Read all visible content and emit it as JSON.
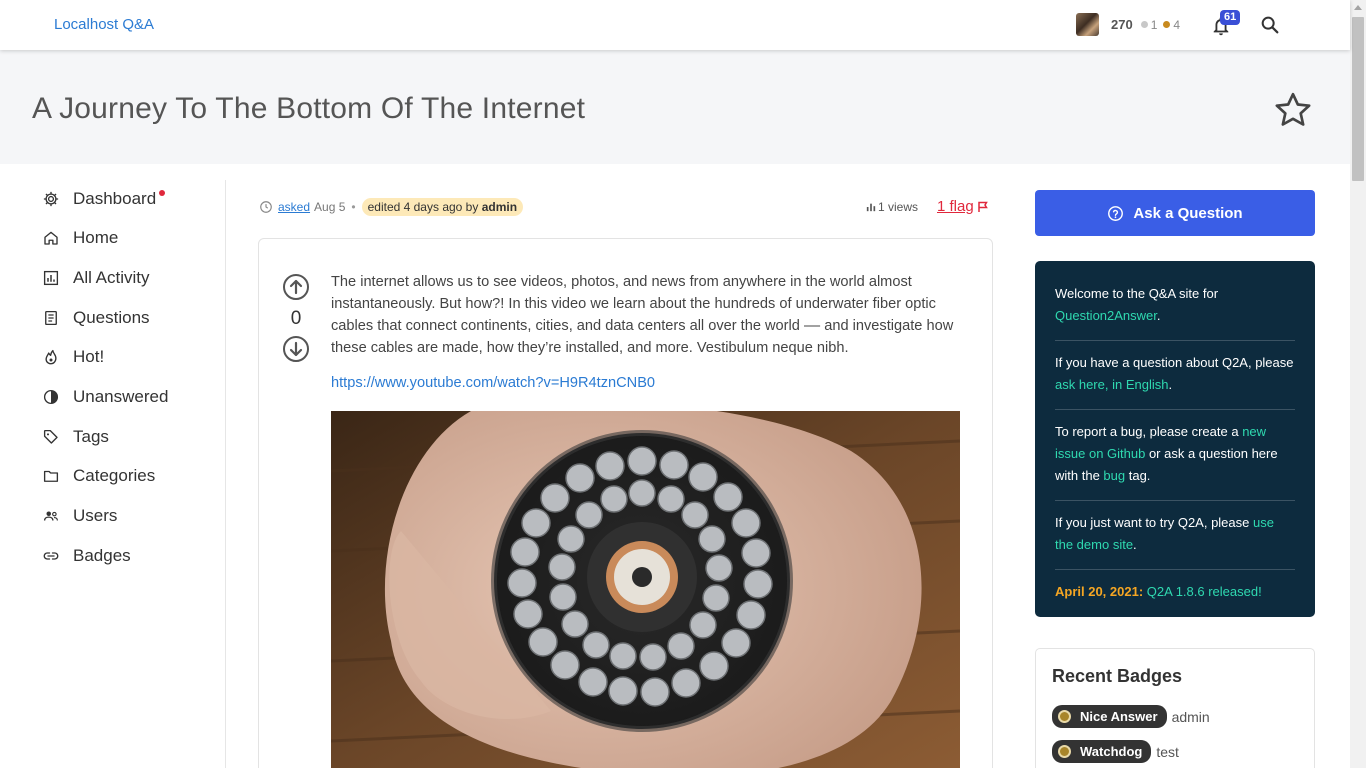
{
  "site": {
    "name": "Localhost Q&A"
  },
  "user": {
    "points": "270",
    "silver": "1",
    "bronze": "4",
    "notifications": "61"
  },
  "title": "A Journey To The Bottom Of The Internet",
  "nav": [
    {
      "label": "Dashboard"
    },
    {
      "label": "Home"
    },
    {
      "label": "All Activity"
    },
    {
      "label": "Questions"
    },
    {
      "label": "Hot!"
    },
    {
      "label": "Unanswered"
    },
    {
      "label": "Tags"
    },
    {
      "label": "Categories"
    },
    {
      "label": "Users"
    },
    {
      "label": "Badges"
    }
  ],
  "question": {
    "asked_label": "asked",
    "asked_date": "Aug 5",
    "edited_prefix": "edited 4 days ago by",
    "edited_by": "admin",
    "views": "1 views",
    "flags": "1 flag",
    "votes": "0",
    "body": "The internet allows us to see videos, photos, and news from anywhere in the world almost instantaneously. But how?! In this video we learn about the hundreds of underwater fiber optic cables that connect continents, cities, and data centers all over the world –– and investigate how these cables are made, how they’re installed, and more. Vestibulum neque nibh.",
    "link": "https://www.youtube.com/watch?v=H9R4tznCNB0"
  },
  "sidebar": {
    "ask_button": "Ask a Question",
    "welcome": {
      "s1_text": "Welcome to the Q&A site for ",
      "s1_link": "Question2Answer",
      "s1_end": ".",
      "s2_text": "If you have a question about Q2A, please ",
      "s2_link": "ask here, in English",
      "s2_end": ".",
      "s3_text": "To report a bug, please create a ",
      "s3_link": "new issue on Github",
      "s3_mid": " or ask a question here with the ",
      "s3_link2": "bug",
      "s3_end": " tag.",
      "s4_text": "If you just want to try Q2A, please ",
      "s4_link": "use the demo site",
      "s4_end": ".",
      "s5_date": "April 20, 2021:",
      "s5_link": "Q2A 1.8.6 released!"
    },
    "recent_badges": {
      "title": "Recent Badges",
      "items": [
        {
          "badge": "Nice Answer",
          "user": "admin"
        },
        {
          "badge": "Watchdog",
          "user": "test"
        }
      ]
    }
  },
  "colors": {
    "accent": "#3a5ee6",
    "link": "#2b7bd3",
    "welcome_bg": "#0d2b3e",
    "welcome_link": "#2fd9b0",
    "flag": "#e0283c"
  }
}
